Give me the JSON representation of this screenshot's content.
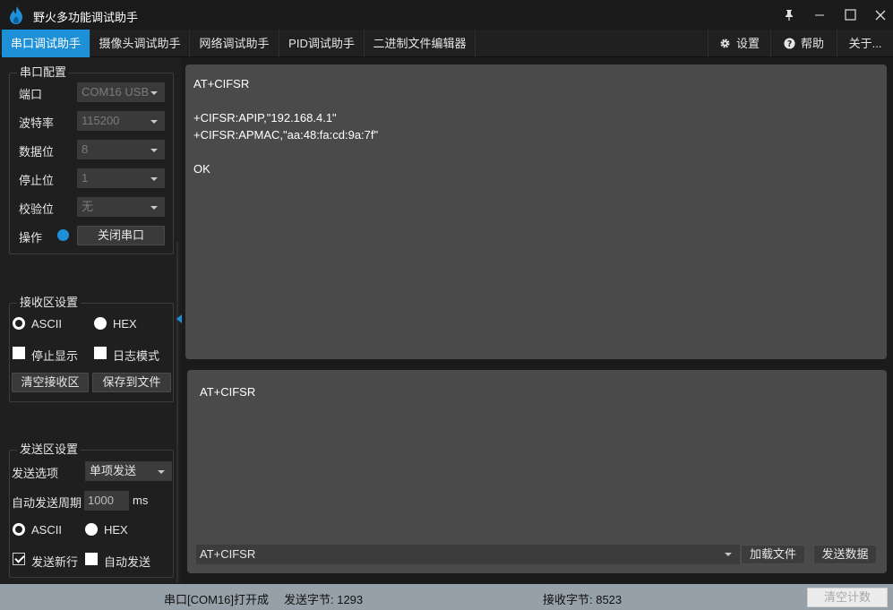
{
  "window": {
    "title": "野火多功能调试助手"
  },
  "tabs": [
    {
      "label": "串口调试助手",
      "active": true
    },
    {
      "label": "摄像头调试助手"
    },
    {
      "label": "网络调试助手"
    },
    {
      "label": "PID调试助手"
    },
    {
      "label": "二进制文件编辑器"
    }
  ],
  "right_tabs": {
    "settings": "设置",
    "help": "帮助",
    "about": "关于..."
  },
  "serial_config": {
    "title": "串口配置",
    "port_label": "端口",
    "port_value": "COM16 USB",
    "baud_label": "波特率",
    "baud_value": "115200",
    "databits_label": "数据位",
    "databits_value": "8",
    "stopbits_label": "停止位",
    "stopbits_value": "1",
    "parity_label": "校验位",
    "parity_value": "无",
    "operation_label": "操作",
    "close_port_button": "关闭串口"
  },
  "recv_settings": {
    "title": "接收区设置",
    "ascii": "ASCII",
    "hex": "HEX",
    "ascii_selected": false,
    "hex_selected": true,
    "pause_display": "停止显示",
    "log_mode": "日志模式",
    "clear_button": "清空接收区",
    "save_button": "保存到文件"
  },
  "send_settings": {
    "title": "发送区设置",
    "option_label": "发送选项",
    "option_value": "单项发送",
    "period_label": "自动发送周期",
    "period_value": "1000",
    "period_unit": "ms",
    "ascii": "ASCII",
    "hex": "HEX",
    "ascii_selected": false,
    "hex_selected": true,
    "newline": "发送新行",
    "newline_checked": true,
    "auto_send": "自动发送",
    "auto_send_checked": false
  },
  "receive_area": {
    "lines": [
      "AT+CIFSR",
      "",
      "+CIFSR:APIP,\"192.168.4.1\"",
      "+CIFSR:APMAC,\"aa:48:fa:cd:9a:7f\"",
      "",
      "OK"
    ]
  },
  "send_area": {
    "text": "AT+CIFSR",
    "history_value": "AT+CIFSR",
    "load_file_button": "加载文件",
    "send_button": "发送数据"
  },
  "status_bar": {
    "port_status": "串口[COM16]打开成",
    "sent_bytes": "发送字节: 1293",
    "recv_bytes": "接收字节: 8523",
    "clear_count_button": "清空计数"
  },
  "colors": {
    "accent": "#1e90d8",
    "status_bar": "#95a0a8",
    "text_area": "#4a4a4a"
  }
}
